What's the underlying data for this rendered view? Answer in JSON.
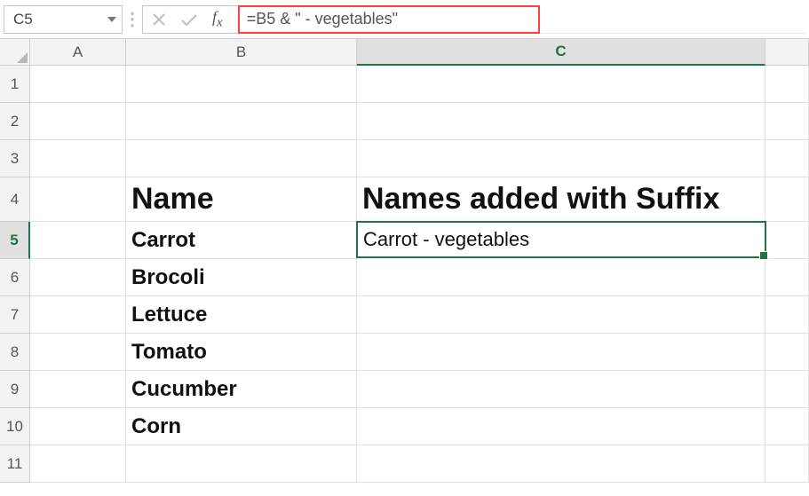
{
  "formula_bar": {
    "cell_ref": "C5",
    "formula": "=B5 & \" - vegetables\""
  },
  "columns": [
    "A",
    "B",
    "C"
  ],
  "selected_col": "C",
  "selected_row": "5",
  "row_numbers": [
    "1",
    "2",
    "3",
    "4",
    "5",
    "6",
    "7",
    "8",
    "9",
    "10",
    "11"
  ],
  "cells": {
    "B4": "Name",
    "C4": "Names added with Suffix",
    "B5": "Carrot",
    "C5": "Carrot - vegetables",
    "B6": "Brocoli",
    "B7": "Lettuce",
    "B8": "Tomato",
    "B9": "Cucumber",
    "B10": "Corn"
  }
}
